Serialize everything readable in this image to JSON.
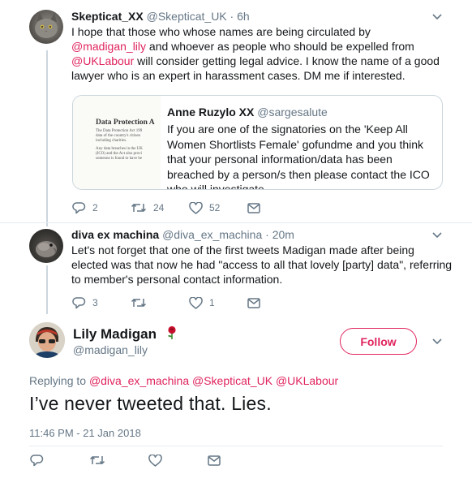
{
  "tweets": [
    {
      "name": "Skepticat_XX",
      "handle": "@Skepticat_UK",
      "separator": "·",
      "time": "6h",
      "text_parts": [
        "I hope that those who whose names are being circulated by ",
        "@madigan_lily",
        " and whoever as people who should be expelled from ",
        "@UKLabour",
        " will consider getting legal advice. I know the name of a good lawyer who is an expert in harassment cases. DM me if interested."
      ],
      "quote": {
        "name": "Anne Ruzylo XX",
        "handle": "@sargesalute",
        "text": "If you are one of the signatories on the 'Keep All Women Shortlists Female' gofundme and you think that your personal information/data has been breached by a person/s then please contact the ICO who will investigate.",
        "image": {
          "title": "Data Protection A",
          "para1": "The Data Protection Act 199\ndata of the country's citizen\nincluding charities.",
          "para2": "Any data breaches in the UK\n(ICO) and the Act also provi\nsomeone is found to have be"
        }
      },
      "stats": {
        "replies": "2",
        "retweets": "24",
        "likes": "52"
      }
    },
    {
      "name": "diva ex machina",
      "handle": "@diva_ex_machina",
      "separator": "·",
      "time": "20m",
      "text": "Let's not forget that one of the first tweets Madigan made after being elected was that now he had \"access to all that lovely [party] data\", referring to member's personal contact information.",
      "stats": {
        "replies": "3",
        "retweets": "",
        "likes": "1"
      }
    }
  ],
  "main_tweet": {
    "name": "Lily Madigan",
    "name_emoji": "🌹",
    "handle": "@madigan_lily",
    "follow_label": "Follow",
    "replying_label": "Replying to",
    "replying_to": [
      "@diva_ex_machina",
      "@Skepticat_UK",
      "@UKLabour"
    ],
    "text": "I’ve never tweeted that. Lies.",
    "timestamp": "11:46 PM - 21 Jan 2018"
  },
  "colors": {
    "accent": "#e0245e",
    "text": "#14171a",
    "secondary": "#657786",
    "border": "#ccd6dd"
  },
  "icons": [
    "chevron-down-icon",
    "reply-icon",
    "retweet-icon",
    "like-icon",
    "message-icon",
    "rose-emoji"
  ]
}
